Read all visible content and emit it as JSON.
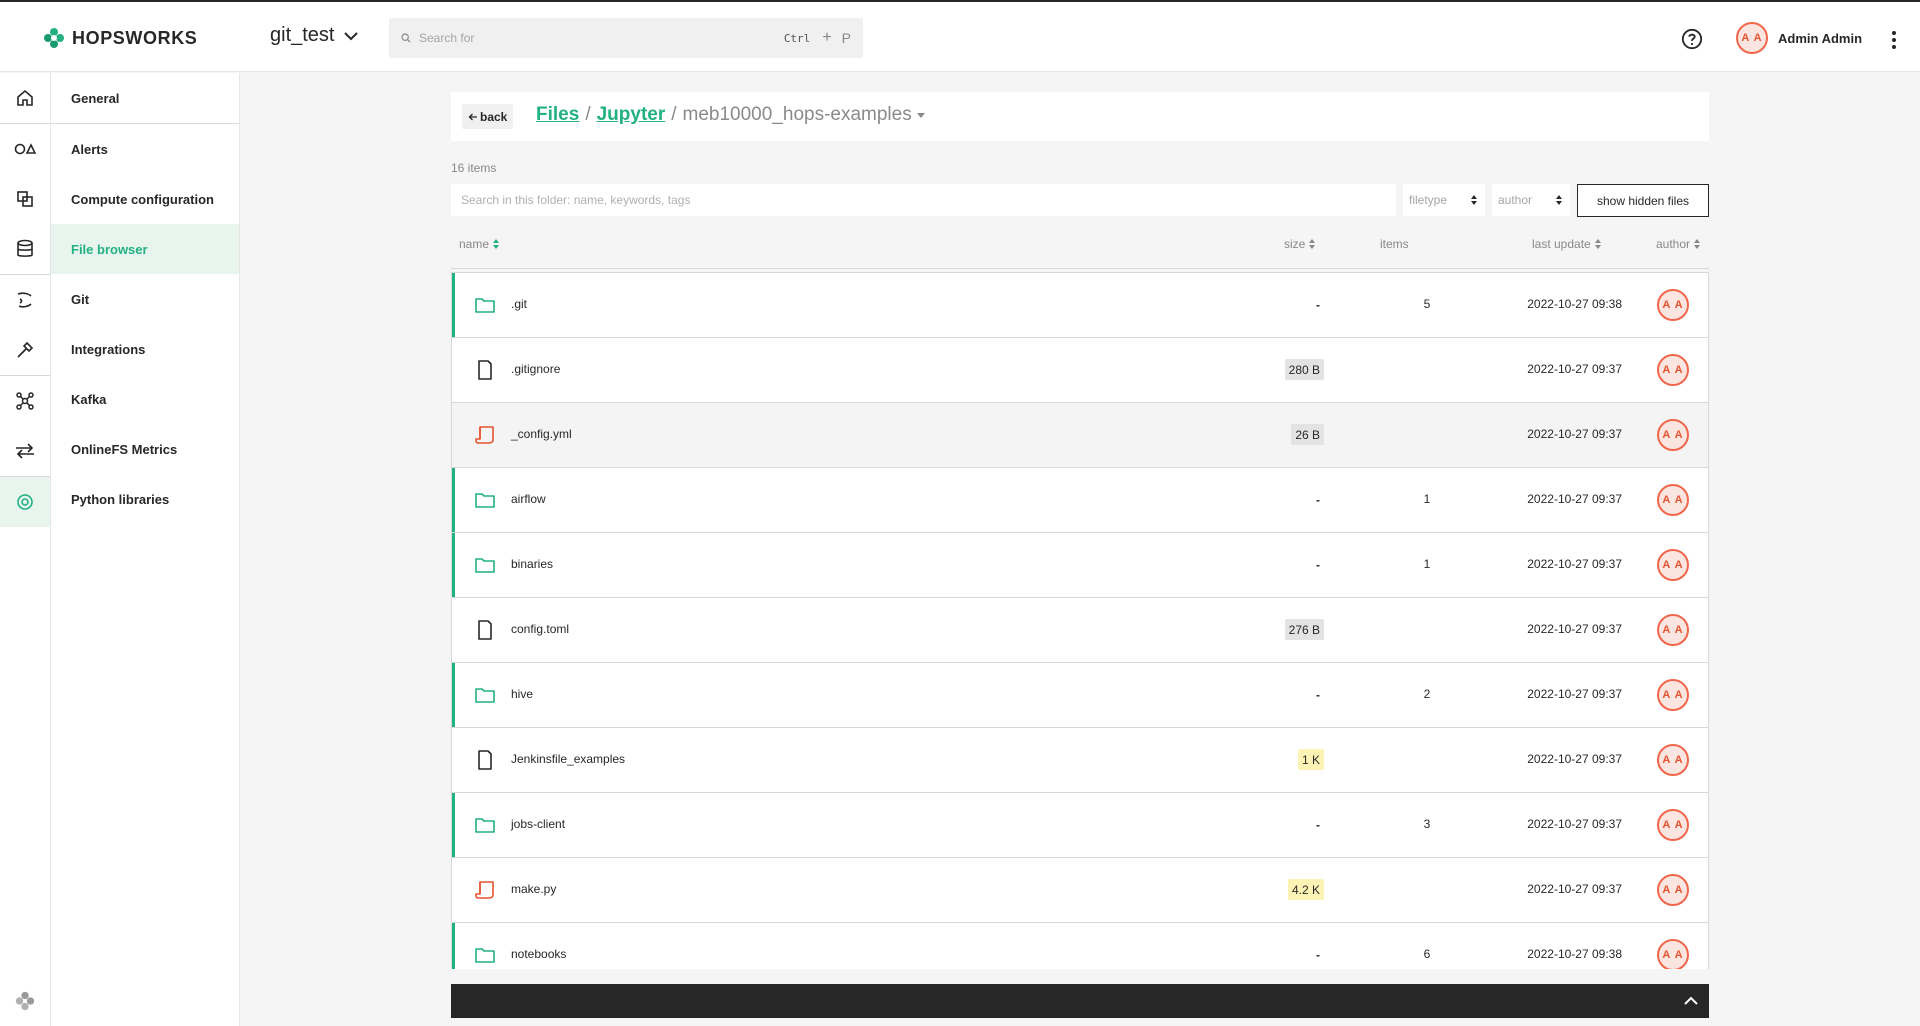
{
  "app": {
    "logo_text": "HOPSWORKS",
    "project_name": "git_test",
    "search_placeholder": "Search for",
    "shortcut_ctrl": "Ctrl",
    "shortcut_plus": "+",
    "shortcut_key": "P",
    "user_initials": "A A",
    "user_name": "Admin Admin"
  },
  "rail": {
    "icons": [
      "home-icon",
      "alerts-icon",
      "compute-icon",
      "database-icon",
      "git-icon",
      "integrations-icon",
      "kafka-icon",
      "transfer-icon",
      "settings-icon"
    ],
    "active": "settings-icon"
  },
  "sidebar": {
    "items": [
      {
        "label": "General"
      },
      {
        "label": "Alerts"
      },
      {
        "label": "Compute configuration"
      },
      {
        "label": "File browser",
        "active": true
      },
      {
        "label": "Git"
      },
      {
        "label": "Integrations"
      },
      {
        "label": "Kafka"
      },
      {
        "label": "OnlineFS Metrics"
      },
      {
        "label": "Python libraries"
      }
    ]
  },
  "header": {
    "back_label": "back",
    "breadcrumb": [
      "Files",
      "Jupyter"
    ],
    "current": "meb10000_hops-examples"
  },
  "toolbar": {
    "item_count": "16 items",
    "search_placeholder": "Search in this folder: name, keywords, tags",
    "filetype_label": "filetype",
    "author_label": "author",
    "hidden_files_label": "show hidden files"
  },
  "columns": {
    "name": "name",
    "size": "size",
    "items": "items",
    "last_update": "last update",
    "author": "author"
  },
  "files": [
    {
      "name": ".git",
      "type": "folder",
      "size": "-",
      "items": "5",
      "date": "2022-10-27 09:38",
      "author": "A A"
    },
    {
      "name": ".gitignore",
      "type": "file",
      "size": "280 B",
      "size_style": "gray",
      "items": "",
      "date": "2022-10-27 09:37",
      "author": "A A"
    },
    {
      "name": "_config.yml",
      "type": "script",
      "size": "26 B",
      "size_style": "gray",
      "items": "",
      "date": "2022-10-27 09:37",
      "author": "A A",
      "highlight": true
    },
    {
      "name": "airflow",
      "type": "folder",
      "size": "-",
      "items": "1",
      "date": "2022-10-27 09:37",
      "author": "A A"
    },
    {
      "name": "binaries",
      "type": "folder",
      "size": "-",
      "items": "1",
      "date": "2022-10-27 09:37",
      "author": "A A"
    },
    {
      "name": "config.toml",
      "type": "file",
      "size": "276 B",
      "size_style": "gray",
      "items": "",
      "date": "2022-10-27 09:37",
      "author": "A A"
    },
    {
      "name": "hive",
      "type": "folder",
      "size": "-",
      "items": "2",
      "date": "2022-10-27 09:37",
      "author": "A A"
    },
    {
      "name": "Jenkinsfile_examples",
      "type": "file",
      "size": "1 K",
      "size_style": "yellow",
      "items": "",
      "date": "2022-10-27 09:37",
      "author": "A A"
    },
    {
      "name": "jobs-client",
      "type": "folder",
      "size": "-",
      "items": "3",
      "date": "2022-10-27 09:37",
      "author": "A A"
    },
    {
      "name": "make.py",
      "type": "script",
      "size": "4.2 K",
      "size_style": "yellow",
      "items": "",
      "date": "2022-10-27 09:37",
      "author": "A A"
    },
    {
      "name": "notebooks",
      "type": "folder",
      "size": "-",
      "items": "6",
      "date": "2022-10-27 09:38",
      "author": "A A"
    }
  ],
  "colors": {
    "accent": "#21b182",
    "avatar_border": "#f0664b",
    "script_icon": "#e5532f",
    "dark_bar": "#272727"
  }
}
